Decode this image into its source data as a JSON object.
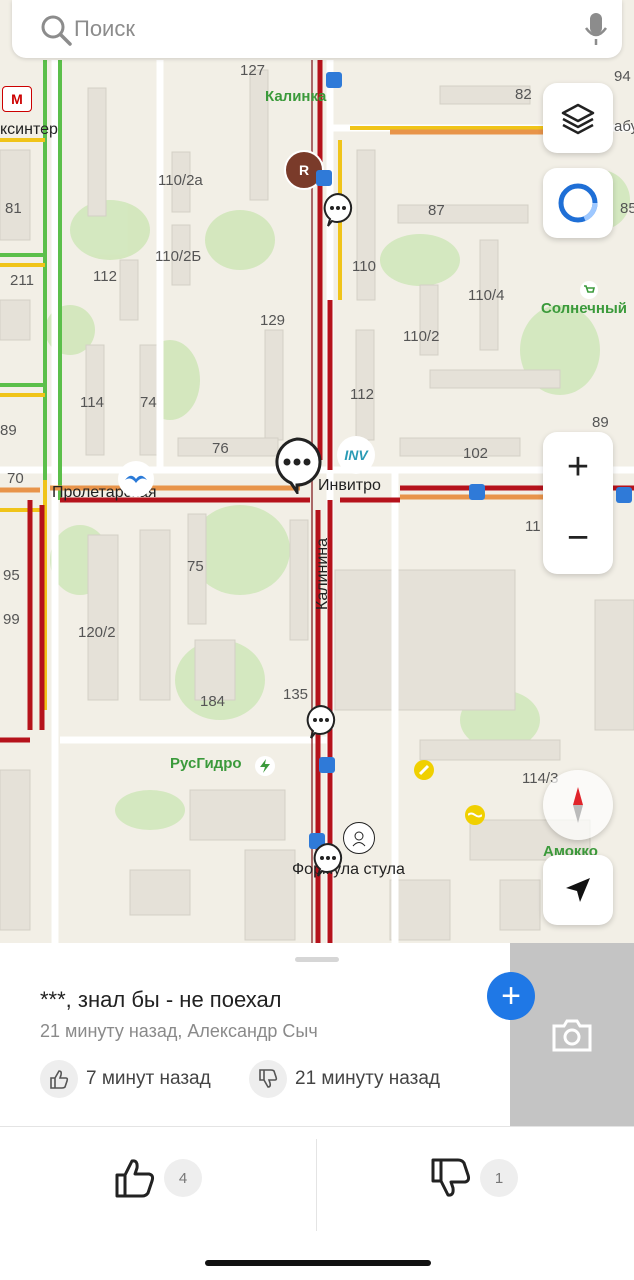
{
  "search": {
    "placeholder": "Поиск",
    "search_icon": "search-icon",
    "mic_icon": "microphone-icon"
  },
  "map": {
    "streets": {
      "kalinina": "Калинина",
      "proletarskaya": "Пролетарская"
    },
    "places": {
      "kalinka": "Калинка",
      "invitro": "Инвитро",
      "rusgidro": "РусГидро",
      "solnechny": "Солнечный",
      "formula": "Формула стула",
      "amokko": "Амокко",
      "ksinter": "ксинтер",
      "zabu": "абу"
    },
    "poi_badges": {
      "invitro_logo": "INV",
      "restaurant_letter": "R",
      "left_logo": "M"
    },
    "buildings": [
      "127",
      "110/2а",
      "110/2Б",
      "112",
      "110",
      "129",
      "114",
      "74",
      "76",
      "87",
      "82",
      "94",
      "110/4",
      "110/2",
      "112",
      "89",
      "102",
      "75",
      "120/2",
      "184",
      "135",
      "114/3",
      "81",
      "211",
      "89",
      "70",
      "95",
      "99",
      "11",
      "85"
    ]
  },
  "controls": {
    "layers_icon": "layers-icon",
    "location_icon": "alice-ring-icon",
    "zoom_in": "+",
    "zoom_out": "−",
    "compass_icon": "compass-icon",
    "navigate_icon": "navigation-arrow-icon"
  },
  "comment": {
    "text": "***, знал бы - не поехал",
    "meta": "21 минуту назад, Александр Сыч",
    "like_time": "7 минут назад",
    "dislike_time": "21 минуту назад",
    "add_icon": "plus-icon",
    "camera_icon": "camera-icon"
  },
  "votes": {
    "likes": "4",
    "dislikes": "1"
  },
  "colors": {
    "jam_red": "#b5121b",
    "slow_orange": "#e8944a",
    "free_green": "#5bbf4a",
    "yellow": "#f0c419",
    "accent_blue": "#1f78e6"
  }
}
